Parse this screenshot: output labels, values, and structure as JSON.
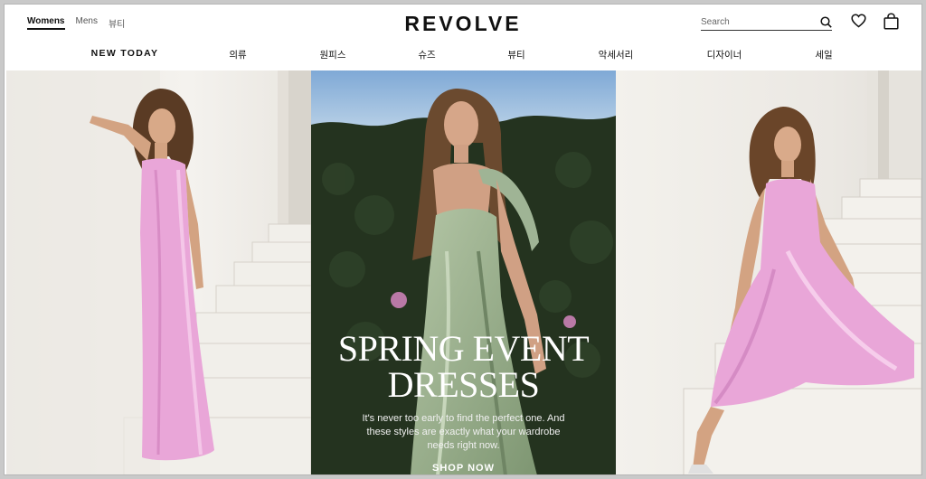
{
  "header": {
    "gender_tabs": [
      {
        "label": "Womens",
        "active": true
      },
      {
        "label": "Mens",
        "active": false
      },
      {
        "label": "뷰티",
        "active": false
      }
    ],
    "logo": "REVOLVE",
    "search": {
      "placeholder": "Search",
      "icon": "search-icon"
    },
    "icons": [
      "heart-icon",
      "shopping-bag-icon"
    ]
  },
  "nav": {
    "items": [
      "NEW TODAY",
      "의류",
      "원피스",
      "슈즈",
      "뷰티",
      "악세서리",
      "디자이너",
      "세일"
    ]
  },
  "hero": {
    "title_line1": "SPRING EVENT",
    "title_line2": "DRESSES",
    "subtitle": "It's never too early to find the perfect one. And these styles are exactly what your wardrobe needs right now.",
    "cta": "SHOP NOW",
    "colors": {
      "dress_pink": "#e9a6d8",
      "dress_green": "#9fb495",
      "hedge": "#1f2a1c",
      "sky": "#8fb6dc"
    }
  }
}
